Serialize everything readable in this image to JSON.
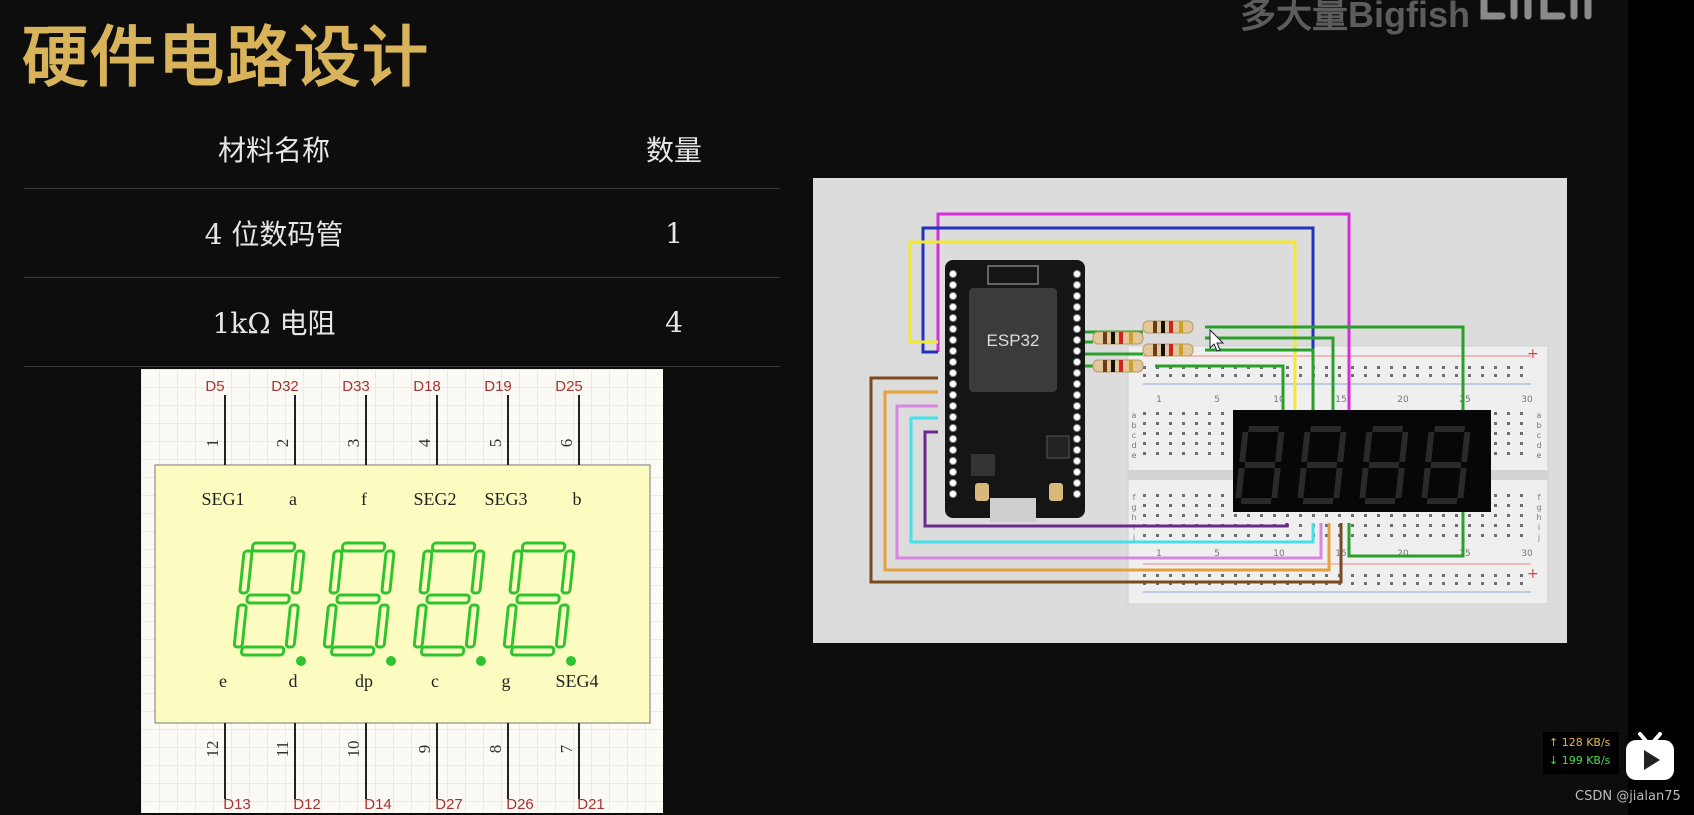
{
  "slide": {
    "title": "硬件电路设计",
    "watermark": "多大量Bigfish"
  },
  "materials_table": {
    "headers": [
      "材料名称",
      "数量"
    ],
    "rows": [
      {
        "name": "4 位数码管",
        "qty": "1"
      },
      {
        "name": "1kΩ 电阻",
        "qty": "4"
      }
    ]
  },
  "pin_diagram": {
    "top_gpio": [
      "D5",
      "D32",
      "D33",
      "D18",
      "D19",
      "D25"
    ],
    "top_pin_numbers": [
      "1",
      "2",
      "3",
      "4",
      "5",
      "6"
    ],
    "top_labels": [
      "SEG1",
      "a",
      "f",
      "SEG2",
      "SEG3",
      "b"
    ],
    "bottom_labels": [
      "e",
      "d",
      "dp",
      "c",
      "g",
      "SEG4"
    ],
    "bottom_pin_numbers": [
      "12",
      "11",
      "10",
      "9",
      "8",
      "7"
    ],
    "bottom_gpio": [
      "D13",
      "D12",
      "D14",
      "D27",
      "D26",
      "D21"
    ],
    "segment_color": "#2fc42f",
    "body_color": "#fcfcc0"
  },
  "circuit": {
    "board_label": "ESP32",
    "breadboard_numbers": [
      "1",
      "5",
      "10",
      "15",
      "20",
      "25",
      "30"
    ],
    "breadboard_rows": [
      "a",
      "b",
      "c",
      "d",
      "e",
      "f",
      "g",
      "h",
      "i",
      "j"
    ],
    "rail_plus": "+"
  },
  "overlay": {
    "upload_speed": "↑ 128 KB/s",
    "download_speed": "↓ 199 KB/s",
    "credit": "CSDN @jialan75"
  }
}
